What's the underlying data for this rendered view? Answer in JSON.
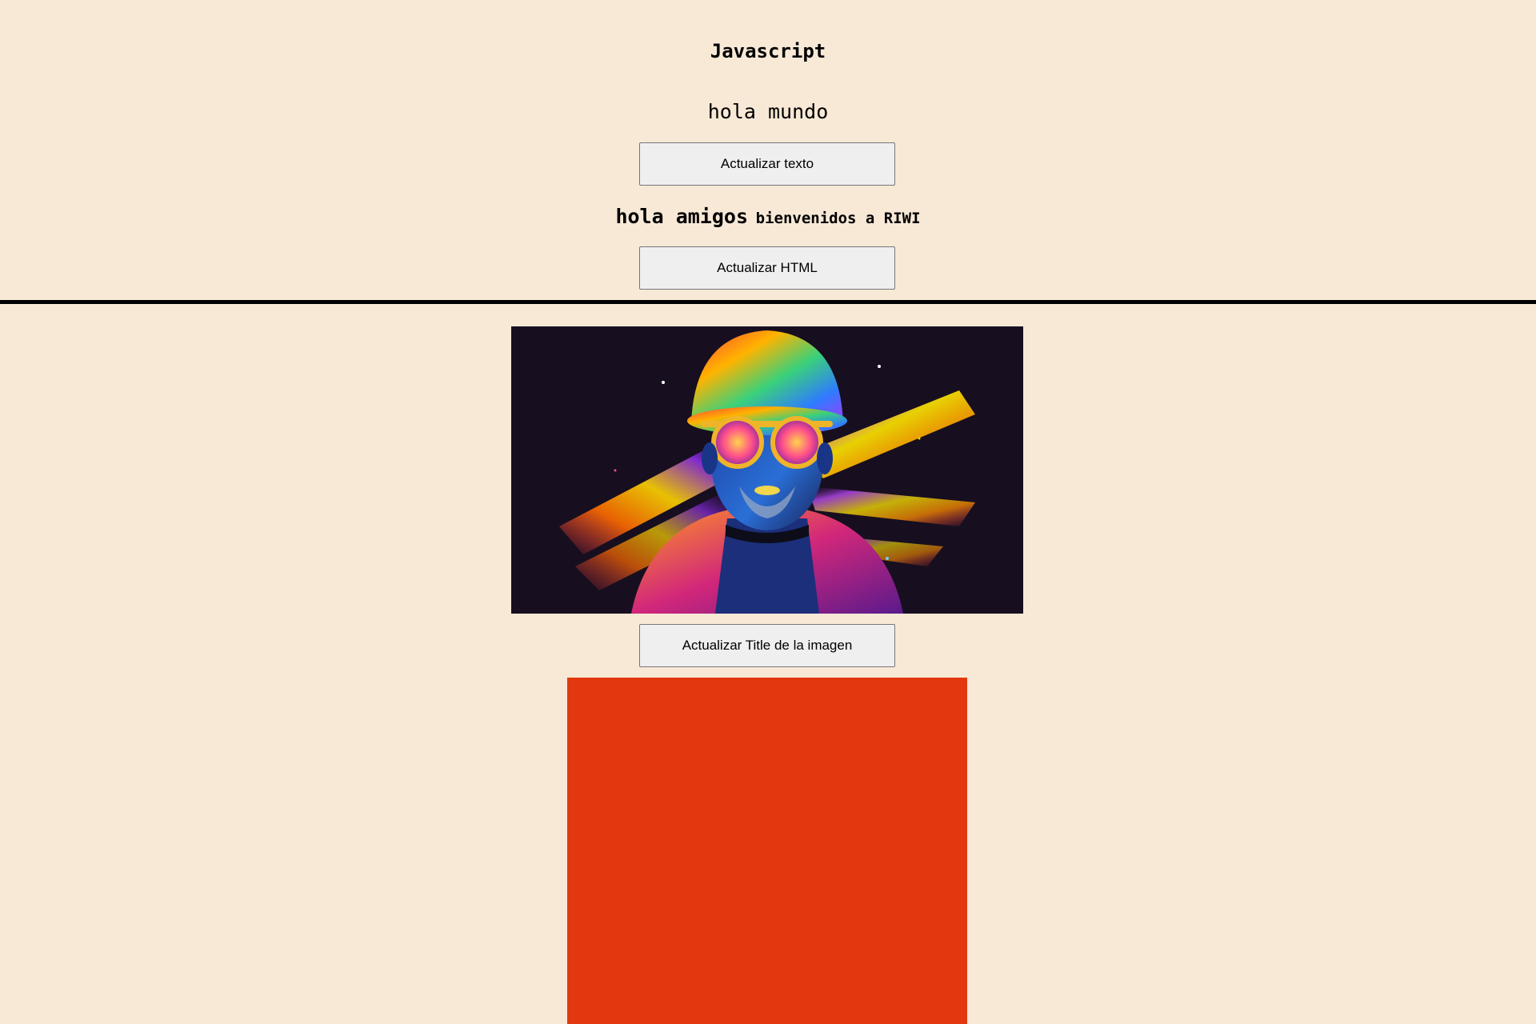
{
  "header": {
    "title": "Javascript",
    "text_paragraph": "hola mundo"
  },
  "buttons": {
    "update_text": "Actualizar texto",
    "update_html": "Actualizar HTML",
    "update_image_title": "Actualizar Title de la imagen"
  },
  "html_line": {
    "strong": "hola amigos",
    "rest": "bienvenidos a RIWI"
  },
  "colors": {
    "background": "#f8e9d7",
    "divider": "#000000",
    "red_box": "#e3380f",
    "button_bg": "#efefef"
  },
  "image": {
    "description_icon": "neon-portrait-image"
  }
}
